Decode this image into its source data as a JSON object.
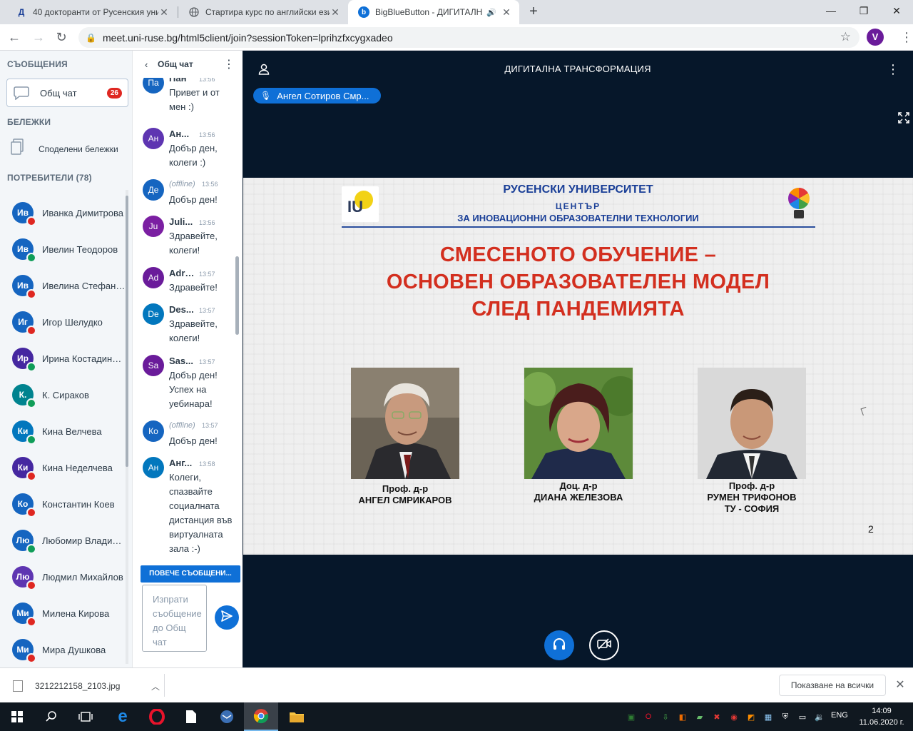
{
  "browser": {
    "tabs": [
      {
        "title": "40 докторанти от Русенския уни",
        "favicon": "Д",
        "active": false
      },
      {
        "title": "Стартира курс по английски ези",
        "favicon": "globe-icon",
        "active": false
      },
      {
        "title": "BigBlueButton - ДИГИТАЛН",
        "favicon": "b",
        "active": true
      }
    ],
    "new_tab": "+",
    "url": "meet.uni-ruse.bg/html5client/join?sessionToken=lprihzfxcygxadeo",
    "profile_initial": "V"
  },
  "userpanel": {
    "messages_header": "СЪОБЩЕНИЯ",
    "public_chat_label": "Общ чат",
    "unread_badge": "26",
    "notes_header": "БЕЛЕЖКИ",
    "shared_notes_label": "Споделени бележки",
    "users_header": "ПОТРЕБИТЕЛИ (78)",
    "users": [
      {
        "initials": "Ив",
        "name": "Иванка Димитрова",
        "status": "muted",
        "color": "#1565c0"
      },
      {
        "initials": "Ив",
        "name": "Ивелин Теодоров",
        "status": "listen",
        "color": "#1565c0"
      },
      {
        "initials": "Ив",
        "name": "Ивелина Стефанова",
        "status": "muted",
        "color": "#1565c0"
      },
      {
        "initials": "Иг",
        "name": "Игор Шелудко",
        "status": "muted",
        "color": "#1565c0"
      },
      {
        "initials": "Ир",
        "name": "Ирина Костадинова",
        "status": "listen",
        "color": "#4527a0"
      },
      {
        "initials": "К.",
        "name": "К. Сираков",
        "status": "listen",
        "color": "#00838f"
      },
      {
        "initials": "Ки",
        "name": "Кина Велчева",
        "status": "listen",
        "color": "#0277bd"
      },
      {
        "initials": "Ки",
        "name": "Кина Неделчева",
        "status": "muted",
        "color": "#4527a0"
      },
      {
        "initials": "Ко",
        "name": "Константин Коев",
        "status": "muted",
        "color": "#1565c0"
      },
      {
        "initials": "Лю",
        "name": "Любомир Владимиров",
        "status": "listen",
        "color": "#1565c0"
      },
      {
        "initials": "Лю",
        "name": "Людмил Михайлов",
        "status": "muted",
        "color": "#5e35b1"
      },
      {
        "initials": "Ми",
        "name": "Милена Кирова",
        "status": "muted",
        "color": "#1565c0"
      },
      {
        "initials": "Ми",
        "name": "Мира Душкова",
        "status": "muted",
        "color": "#1565c0"
      }
    ]
  },
  "chat": {
    "title": "Общ чат",
    "messages": [
      {
        "initials": "Па",
        "color": "#1565c0",
        "name": "Пан",
        "time": "13:56",
        "text": "Привет и от мен :)",
        "offline": false,
        "partial": true
      },
      {
        "initials": "Ан",
        "color": "#5e35b1",
        "name": "Ан...",
        "time": "13:56",
        "text": "Добър ден, колеги :)",
        "offline": false
      },
      {
        "initials": "Де",
        "color": "#1565c0",
        "name": "(offline)",
        "time": "13:56",
        "text": "Добър ден!",
        "offline": true
      },
      {
        "initials": "Ju",
        "color": "#7b1fa2",
        "name": "Juli...",
        "time": "13:56",
        "text": "Здравейте, колеги!",
        "offline": false
      },
      {
        "initials": "Ad",
        "color": "#6a1b9a",
        "name": "Adri...",
        "time": "13:57",
        "text": "Здравейте!",
        "offline": false
      },
      {
        "initials": "De",
        "color": "#0277bd",
        "name": "Des...",
        "time": "13:57",
        "text": "Здравейте, колеги!",
        "offline": false
      },
      {
        "initials": "Sa",
        "color": "#6a1b9a",
        "name": "Sas...",
        "time": "13:57",
        "text": "Добър ден! Успех на уебинара!",
        "offline": false
      },
      {
        "initials": "Ко",
        "color": "#1565c0",
        "name": "(offline)",
        "time": "13:57",
        "text": "Добър ден!",
        "offline": true
      },
      {
        "initials": "Ан",
        "color": "#0277bd",
        "name": "Анг...",
        "time": "13:58",
        "text": "Колеги, спазвайте социалната дистанция във виртуалната зала :-)",
        "offline": false
      }
    ],
    "more_messages_label": "ПОВЕЧЕ СЪОБЩЕНИ...",
    "input_placeholder": "Изпрати съобщение до Общ чат"
  },
  "stage": {
    "title": "ДИГИТАЛНА ТРАНСФОРМАЦИЯ",
    "talker": "Ангел Сотиров Смр...",
    "slide": {
      "university": "РУСЕНСКИ УНИВЕРСИТЕТ",
      "center": "ЦЕНТЪР",
      "center_sub": "ЗА ИНОВАЦИОННИ ОБРАЗОВАТЕЛНИ ТЕХНОЛОГИИ",
      "logo_text": "IU",
      "title_lines": [
        "СМЕСЕНОТО ОБУЧЕНИЕ –",
        "ОСНОВЕН ОБРАЗОВАТЕЛЕН МОДЕЛ",
        "СЛЕД ПАНДЕМИЯТА"
      ],
      "presenters": [
        {
          "line1": "Проф. д-р",
          "line2": "АНГЕЛ СМРИКАРОВ",
          "line3": ""
        },
        {
          "line1": "Доц. д-р",
          "line2": "ДИАНА ЖЕЛЕЗОВА",
          "line3": ""
        },
        {
          "line1": "Проф. д-р",
          "line2": "РУМЕН ТРИФОНОВ",
          "line3": "ТУ - СОФИЯ"
        }
      ],
      "page_number": "2"
    }
  },
  "downloads": {
    "file_name": "3212212158_2103.jpg",
    "show_all_label": "Показване на всички"
  },
  "taskbar": {
    "language": "ENG",
    "time": "14:09",
    "date": "11.06.2020 г."
  },
  "colors": {
    "bbb_blue": "#0f70d7",
    "stage_bg": "#06172a",
    "muted_red": "#df2721",
    "listen_green": "#0f9d58",
    "slide_title_red": "#d32f1f",
    "slide_uni_blue": "#1a3f97"
  }
}
